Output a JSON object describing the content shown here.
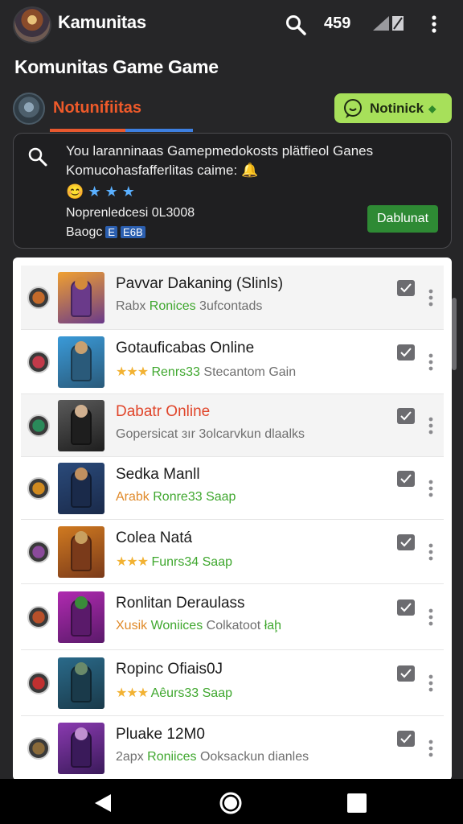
{
  "header": {
    "title": "Kamunitas",
    "count": "459"
  },
  "page": {
    "title": "Komunitas Game Game"
  },
  "community": {
    "name": "Notunifiitas",
    "notify_label": "Notinick"
  },
  "info": {
    "line1": "You laranninaas Gamepmedokosts plätfieol Ganes",
    "line2": "Komucohasfafferlitas caime:",
    "line2_emoji": "🔔",
    "emojis": [
      "😊",
      "★",
      "★",
      "★"
    ],
    "line3": "Noprenledcesi 0L3008",
    "line4": "Baogc",
    "line4_chips": [
      "E",
      "E6B"
    ],
    "download_label": "Dablunat"
  },
  "list": [
    {
      "title": "Pavvar Dakaning (Slinls)",
      "sub": [
        {
          "t": "Rabx ",
          "c": "gray"
        },
        {
          "t": "Ronices",
          "c": "green"
        },
        {
          "t": " 3ufcontads",
          "c": "gray"
        }
      ],
      "title_color": "normal",
      "shade": true,
      "icon_color": "#c46a2a",
      "thumb": [
        "#f0a030",
        "#6a3a8a",
        "#d48a3a"
      ]
    },
    {
      "title": "Gotauficabas Online",
      "sub": [
        {
          "t": "★★★",
          "c": "stars"
        },
        {
          "t": " Renrs33",
          "c": "green"
        },
        {
          "t": " Stecantom Gain",
          "c": "gray"
        }
      ],
      "title_color": "normal",
      "shade": false,
      "icon_color": "#c23a4a",
      "thumb": [
        "#3a9ad8",
        "#2a5a7a",
        "#c8a070"
      ]
    },
    {
      "title": "Dabatr Online",
      "sub": [
        {
          "t": "Gopersicat зır  3olcarvkun dlaalks",
          "c": "gray"
        }
      ],
      "title_color": "red",
      "shade": true,
      "icon_color": "#2a8a5a",
      "thumb": [
        "#5a5a5a",
        "#1e1e1e",
        "#d0b090"
      ]
    },
    {
      "title": "Sedka Manll",
      "sub": [
        {
          "t": "Arabk ",
          "c": "orange"
        },
        {
          "t": "Ronre33 Saap",
          "c": "green"
        }
      ],
      "title_color": "normal",
      "shade": false,
      "icon_color": "#d08a20",
      "thumb": [
        "#2a4a7a",
        "#1a2a4a",
        "#c09060"
      ]
    },
    {
      "title": "Colea Natá",
      "sub": [
        {
          "t": "★★★",
          "c": "stars"
        },
        {
          "t": " Funrs34 Saap",
          "c": "green"
        }
      ],
      "title_color": "normal",
      "shade": false,
      "icon_color": "#8a4a9a",
      "thumb": [
        "#d07a20",
        "#7a3a1a",
        "#c8a060"
      ]
    },
    {
      "title": "Ronlitan Deraulass",
      "sub": [
        {
          "t": "Xusik ",
          "c": "orange"
        },
        {
          "t": "Woniices",
          "c": "green"
        },
        {
          "t": " Colkatoot ",
          "c": "gray"
        },
        {
          "t": "łaḩ",
          "c": "green"
        }
      ],
      "title_color": "normal",
      "shade": false,
      "icon_color": "#b8502a",
      "thumb": [
        "#b02ab0",
        "#5a1a6a",
        "#3a8a3a"
      ]
    },
    {
      "title": "Ropinc Ofiais0J",
      "sub": [
        {
          "t": "★★★",
          "c": "stars"
        },
        {
          "t": " Aêurs33 Saap",
          "c": "green"
        }
      ],
      "title_color": "normal",
      "shade": false,
      "icon_color": "#c03030",
      "thumb": [
        "#2a6a8a",
        "#1a3a4a",
        "#6a8a6a"
      ]
    },
    {
      "title": "Pluake 12M0",
      "sub": [
        {
          "t": "2apx ",
          "c": "gray"
        },
        {
          "t": "Roniices",
          "c": "green"
        },
        {
          "t": " Ooksackun dianles",
          "c": "gray"
        }
      ],
      "title_color": "normal",
      "shade": false,
      "icon_color": "#8a6a3a",
      "thumb": [
        "#8a3ab0",
        "#3a1a5a",
        "#c090d0"
      ]
    }
  ],
  "colors": {
    "background": "#262628",
    "accent_red": "#ef5a2a",
    "accent_blue": "#3d7fe0",
    "notify_bg": "#a7e05a",
    "download_bg": "#2e8a34"
  },
  "icons": [
    "app-avatar",
    "search-icon",
    "signal-icon",
    "more-icon",
    "chat-icon",
    "check-icon",
    "back-icon",
    "home-icon",
    "recents-icon"
  ]
}
